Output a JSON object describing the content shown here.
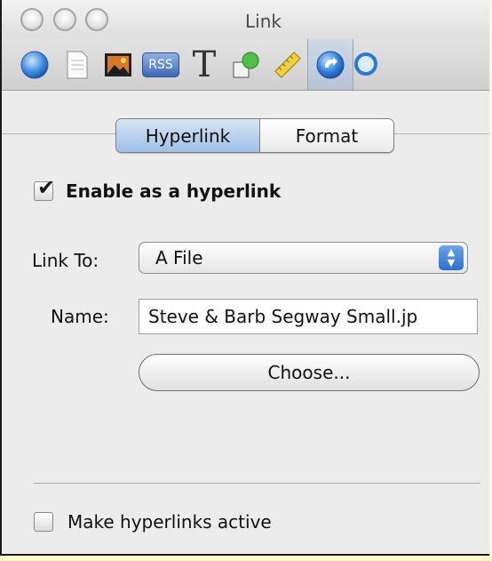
{
  "window": {
    "title": "Link"
  },
  "toolbar": {
    "icons": [
      "globe-icon",
      "document-icon",
      "image-icon",
      "rss-icon",
      "text-icon",
      "shapes-icon",
      "ruler-icon",
      "link-icon",
      "magnifier-icon"
    ],
    "rss_label": "RSS",
    "text_glyph": "T",
    "selected": "link-icon"
  },
  "tabs": {
    "hyperlink": "Hyperlink",
    "format": "Format"
  },
  "enable": {
    "label": "Enable as a hyperlink",
    "checked": true
  },
  "link_to": {
    "label": "Link To:",
    "value": "A File"
  },
  "name": {
    "label": "Name:",
    "value": "Steve & Barb Segway Small.jp"
  },
  "choose_button": "Choose...",
  "make_active": {
    "label": "Make hyperlinks active",
    "checked": false
  },
  "colors": {
    "accent": "#2b6fcf",
    "selected_tab": "#a9c7ea",
    "background": "#fbf8c9"
  }
}
